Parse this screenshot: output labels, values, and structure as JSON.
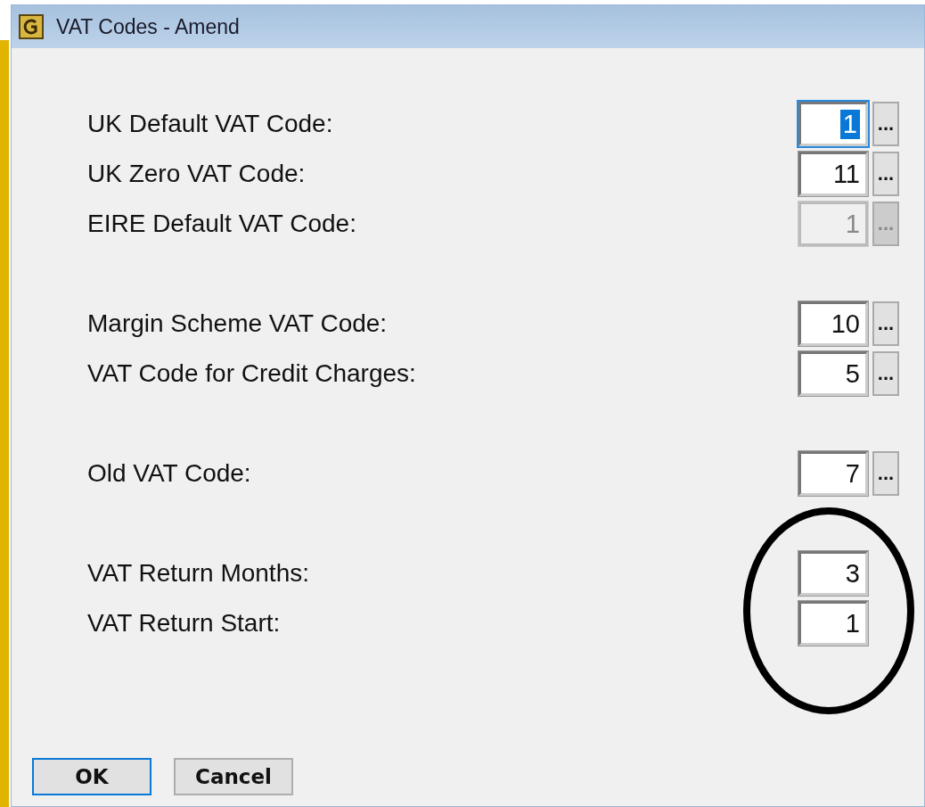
{
  "window": {
    "title": "VAT Codes - Amend"
  },
  "groups": [
    {
      "fields": [
        {
          "label": "UK Default VAT Code:",
          "value": "1",
          "focused": true,
          "disabled": false,
          "lookup": true
        },
        {
          "label": "UK Zero VAT Code:",
          "value": "11",
          "focused": false,
          "disabled": false,
          "lookup": true
        },
        {
          "label": "EIRE Default VAT Code:",
          "value": "1",
          "focused": false,
          "disabled": true,
          "lookup": true
        }
      ]
    },
    {
      "fields": [
        {
          "label": "Margin Scheme VAT Code:",
          "value": "10",
          "focused": false,
          "disabled": false,
          "lookup": true
        },
        {
          "label": "VAT Code for Credit Charges:",
          "value": "5",
          "focused": false,
          "disabled": false,
          "lookup": true
        }
      ]
    },
    {
      "fields": [
        {
          "label": "Old VAT Code:",
          "value": "7",
          "focused": false,
          "disabled": false,
          "lookup": true
        }
      ]
    },
    {
      "fields": [
        {
          "label": "VAT Return Months:",
          "value": "3",
          "focused": false,
          "disabled": false,
          "lookup": false
        },
        {
          "label": "VAT Return Start:",
          "value": "1",
          "focused": false,
          "disabled": false,
          "lookup": false
        }
      ]
    }
  ],
  "lookup_button": {
    "label": "..."
  },
  "buttons": [
    {
      "label": "OK",
      "default": true
    },
    {
      "label": "Cancel",
      "default": false
    }
  ],
  "annotation": {
    "kind": "ellipse"
  }
}
